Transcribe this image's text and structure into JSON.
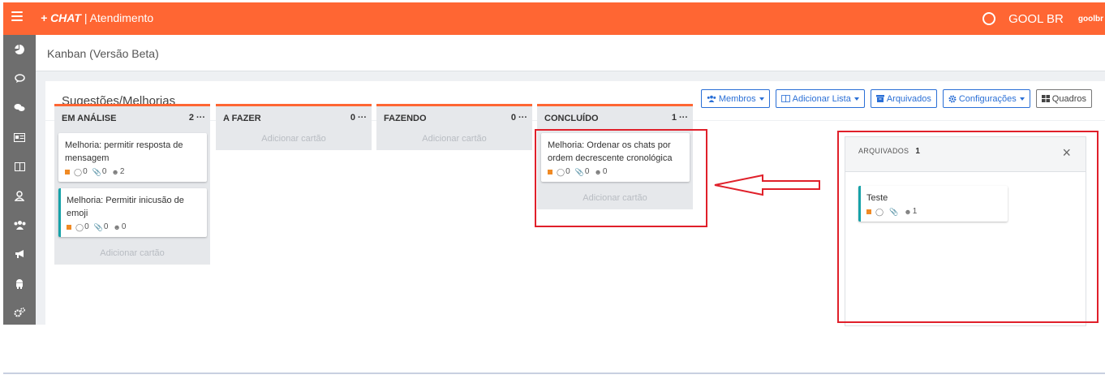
{
  "app": {
    "brand_mark": "+ CHAT",
    "brand_separator": "|",
    "brand_section": "Atendimento",
    "company": "GOOL BR",
    "user": "goolbr"
  },
  "page": {
    "title": "Kanban (Versão Beta)"
  },
  "board": {
    "title": "Sugestões/Melhorias",
    "buttons": {
      "members": "Membros",
      "add_list": "Adicionar Lista",
      "archived": "Arquivados",
      "settings": "Configurações",
      "boards": "Quadros"
    },
    "add_card_label": "Adicionar cartão",
    "lists": [
      {
        "name": "EM ANÁLISE",
        "count": "2",
        "cards": [
          {
            "title": "Melhoria: permitir resposta de mensagem",
            "comments": "0",
            "attachments": "0",
            "members": "2"
          },
          {
            "title": "Melhoria: Permitir inicusão de emoji",
            "comments": "0",
            "attachments": "0",
            "members": "0"
          }
        ]
      },
      {
        "name": "A FAZER",
        "count": "0"
      },
      {
        "name": "FAZENDO",
        "count": "0"
      },
      {
        "name": "CONCLUÍDO",
        "count": "1",
        "cards": [
          {
            "title": "Melhoria: Ordenar os chats por ordem decrescente cronológica",
            "comments": "0",
            "attachments": "0",
            "members": "0"
          }
        ]
      }
    ]
  },
  "archived_panel": {
    "title": "ARQUIVADOS",
    "count": "1",
    "close": "×",
    "cards": [
      {
        "title": "Teste",
        "members": "1"
      }
    ]
  },
  "colors": {
    "brand": "#ff6633",
    "sidebar": "#6e6e6e",
    "primary": "#2a6fd6",
    "annotation": "#e0202a",
    "label_orange": "#f08a24",
    "teal": "#17a2a8"
  },
  "icons": [
    "menu-icon",
    "whatsapp-icon",
    "dashboard-icon",
    "chat-icon",
    "chats-icon",
    "id-card-icon",
    "columns-icon",
    "user-icon",
    "users-icon",
    "megaphone-icon",
    "android-icon",
    "gears-icon",
    "comment-icon",
    "paperclip-icon",
    "archive-icon",
    "cog-icon",
    "grid-icon",
    "close-icon",
    "arrow-annotation"
  ]
}
